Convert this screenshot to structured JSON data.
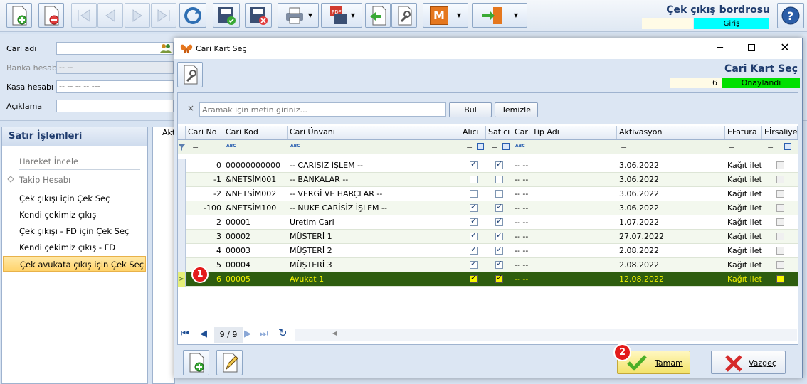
{
  "window": {
    "title": "Çek çıkış bordrosu",
    "status_label": "Giriş"
  },
  "form": {
    "cari_label": "Cari adı",
    "banka_label": "Banka hesabı",
    "banka_value": "-- --",
    "kasa_label": "Kasa hesabı",
    "kasa_value": "-- -- -- -- ---",
    "aciklama_label": "Açıklama"
  },
  "sidebar": {
    "title": "Satır İşlemleri",
    "items": [
      {
        "label": "Hareket İncele"
      },
      {
        "label": "Takip Hesabı"
      },
      {
        "label": "Çek çıkışı için Çek Seç"
      },
      {
        "label": "Kendi çekimiz çıkış"
      },
      {
        "label": "Çek çıkışı - FD için Çek Seç"
      },
      {
        "label": "Kendi çekimiz çıkış - FD"
      },
      {
        "label": "Çek avukata çıkış için Çek Seç"
      }
    ]
  },
  "background_grid": {
    "first_header": "Akt"
  },
  "dialog": {
    "title": "Cari Kart Seç",
    "heading": "Cari Kart Seç",
    "count": "6",
    "status": "Onaylandı",
    "search_placeholder": "Aramak için metin giriniz...",
    "search_clear": "×",
    "find_button": "Bul",
    "clear_button": "Temizle",
    "ok_button": "Tamam",
    "cancel_button": "Vazgeç",
    "pager": "9 / 9",
    "badge1": "1",
    "badge2": "2",
    "filter_eq": "=",
    "filter_abc": "ABC",
    "columns": [
      "Cari No",
      "Cari Kod",
      "Cari Ünvanı",
      "Alıcı",
      "Satıcı",
      "Cari Tip Adı",
      "Aktivasyon",
      "EFatura",
      "Eİrsaliye"
    ],
    "rows": [
      {
        "no": "0",
        "kod": "00000000000",
        "unvan": "-- CARİSİZ İŞLEM --",
        "alici": true,
        "satici": true,
        "tip": "-- --",
        "akt": "3.06.2022",
        "efatura": "Kağıt iletin",
        "eirs": false
      },
      {
        "no": "-1",
        "kod": "&NETSİM001",
        "unvan": "-- BANKALAR --",
        "alici": false,
        "satici": false,
        "tip": "-- --",
        "akt": "3.06.2022",
        "efatura": "Kağıt iletin",
        "eirs": false
      },
      {
        "no": "-2",
        "kod": "&NETSİM002",
        "unvan": "-- VERGİ VE HARÇLAR --",
        "alici": false,
        "satici": false,
        "tip": "-- --",
        "akt": "3.06.2022",
        "efatura": "Kağıt iletin",
        "eirs": false
      },
      {
        "no": "-100",
        "kod": "&NETSİM100",
        "unvan": "-- NUKE CARİSİZ İŞLEM --",
        "alici": true,
        "satici": true,
        "tip": "-- --",
        "akt": "3.06.2022",
        "efatura": "Kağıt iletin",
        "eirs": false
      },
      {
        "no": "2",
        "kod": "00001",
        "unvan": "Üretim Cari",
        "alici": true,
        "satici": true,
        "tip": "-- --",
        "akt": "1.07.2022",
        "efatura": "Kağıt iletin",
        "eirs": false
      },
      {
        "no": "3",
        "kod": "00002",
        "unvan": "MÜŞTERİ 1",
        "alici": true,
        "satici": true,
        "tip": "-- --",
        "akt": "27.07.2022",
        "efatura": "Kağıt iletin",
        "eirs": false
      },
      {
        "no": "4",
        "kod": "00003",
        "unvan": "MÜŞTERİ 2",
        "alici": true,
        "satici": true,
        "tip": "-- --",
        "akt": "2.08.2022",
        "efatura": "Kağıt iletin",
        "eirs": false
      },
      {
        "no": "5",
        "kod": "00004",
        "unvan": "MÜŞTERİ 3",
        "alici": true,
        "satici": true,
        "tip": "-- --",
        "akt": "2.08.2022",
        "efatura": "Kağıt iletin",
        "eirs": false
      },
      {
        "no": "6",
        "kod": "00005",
        "unvan": "Avukat 1",
        "alici": true,
        "satici": true,
        "tip": "-- --",
        "akt": "12.08.2022",
        "efatura": "Kağıt iletin",
        "eirs": false,
        "selected": true
      }
    ]
  },
  "colors": {
    "selected_row": "#2e5d0f",
    "selected_text": "#f2f200",
    "status_green": "#00e000",
    "status_cyan": "#00ffff",
    "badge_red": "#e31b1b"
  }
}
